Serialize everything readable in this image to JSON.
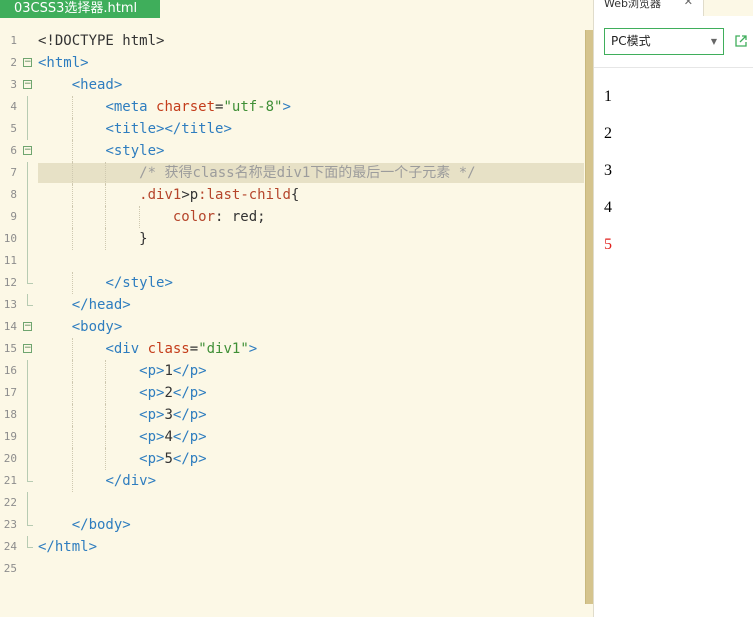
{
  "editor": {
    "file_tab": "03CSS3选择器.html",
    "lines": [
      {
        "n": "1",
        "fold": "",
        "segments": [
          {
            "c": "plain",
            "t": "<!DOCTYPE html>"
          }
        ]
      },
      {
        "n": "2",
        "fold": "open",
        "segments": [
          {
            "c": "tag",
            "t": "<html>"
          }
        ]
      },
      {
        "n": "3",
        "fold": "open",
        "segments": [
          {
            "c": "plain",
            "t": "    "
          },
          {
            "c": "tag",
            "t": "<head>"
          }
        ]
      },
      {
        "n": "4",
        "fold": "line",
        "segments": [
          {
            "c": "plain",
            "t": "        "
          },
          {
            "c": "tag",
            "t": "<meta "
          },
          {
            "c": "attr",
            "t": "charset"
          },
          {
            "c": "plain",
            "t": "="
          },
          {
            "c": "val",
            "t": "\"utf-8\""
          },
          {
            "c": "tag",
            "t": ">"
          }
        ]
      },
      {
        "n": "5",
        "fold": "line",
        "segments": [
          {
            "c": "plain",
            "t": "        "
          },
          {
            "c": "tag",
            "t": "<title></title>"
          }
        ]
      },
      {
        "n": "6",
        "fold": "open",
        "segments": [
          {
            "c": "plain",
            "t": "        "
          },
          {
            "c": "tag",
            "t": "<style>"
          }
        ]
      },
      {
        "n": "7",
        "fold": "line",
        "hl": true,
        "segments": [
          {
            "c": "plain",
            "t": "            "
          },
          {
            "c": "cmt",
            "t": "/* 获得class名称是div1下面的最后一个子元素 */"
          }
        ]
      },
      {
        "n": "8",
        "fold": "line",
        "segments": [
          {
            "c": "plain",
            "t": "            "
          },
          {
            "c": "sel",
            "t": ".div1"
          },
          {
            "c": "plain",
            "t": ">p"
          },
          {
            "c": "sel",
            "t": ":last-child"
          },
          {
            "c": "plain",
            "t": "{"
          }
        ]
      },
      {
        "n": "9",
        "fold": "line",
        "segments": [
          {
            "c": "plain",
            "t": "                "
          },
          {
            "c": "sel",
            "t": "color"
          },
          {
            "c": "plain",
            "t": ": red;"
          }
        ]
      },
      {
        "n": "10",
        "fold": "line",
        "segments": [
          {
            "c": "plain",
            "t": "            }"
          }
        ]
      },
      {
        "n": "11",
        "fold": "line",
        "segments": [
          {
            "c": "plain",
            "t": ""
          }
        ]
      },
      {
        "n": "12",
        "fold": "end",
        "segments": [
          {
            "c": "plain",
            "t": "        "
          },
          {
            "c": "tag",
            "t": "</style>"
          }
        ]
      },
      {
        "n": "13",
        "fold": "end",
        "segments": [
          {
            "c": "plain",
            "t": "    "
          },
          {
            "c": "tag",
            "t": "</head>"
          }
        ]
      },
      {
        "n": "14",
        "fold": "open",
        "segments": [
          {
            "c": "plain",
            "t": "    "
          },
          {
            "c": "tag",
            "t": "<body>"
          }
        ]
      },
      {
        "n": "15",
        "fold": "open",
        "segments": [
          {
            "c": "plain",
            "t": "        "
          },
          {
            "c": "tag",
            "t": "<div "
          },
          {
            "c": "attr",
            "t": "class"
          },
          {
            "c": "plain",
            "t": "="
          },
          {
            "c": "val",
            "t": "\"div1\""
          },
          {
            "c": "tag",
            "t": ">"
          }
        ]
      },
      {
        "n": "16",
        "fold": "line",
        "segments": [
          {
            "c": "plain",
            "t": "            "
          },
          {
            "c": "tag",
            "t": "<p>"
          },
          {
            "c": "plain",
            "t": "1"
          },
          {
            "c": "tag",
            "t": "</p>"
          }
        ]
      },
      {
        "n": "17",
        "fold": "line",
        "segments": [
          {
            "c": "plain",
            "t": "            "
          },
          {
            "c": "tag",
            "t": "<p>"
          },
          {
            "c": "plain",
            "t": "2"
          },
          {
            "c": "tag",
            "t": "</p>"
          }
        ]
      },
      {
        "n": "18",
        "fold": "line",
        "segments": [
          {
            "c": "plain",
            "t": "            "
          },
          {
            "c": "tag",
            "t": "<p>"
          },
          {
            "c": "plain",
            "t": "3"
          },
          {
            "c": "tag",
            "t": "</p>"
          }
        ]
      },
      {
        "n": "19",
        "fold": "line",
        "segments": [
          {
            "c": "plain",
            "t": "            "
          },
          {
            "c": "tag",
            "t": "<p>"
          },
          {
            "c": "plain",
            "t": "4"
          },
          {
            "c": "tag",
            "t": "</p>"
          }
        ]
      },
      {
        "n": "20",
        "fold": "line",
        "segments": [
          {
            "c": "plain",
            "t": "            "
          },
          {
            "c": "tag",
            "t": "<p>"
          },
          {
            "c": "plain",
            "t": "5"
          },
          {
            "c": "tag",
            "t": "</p>"
          }
        ]
      },
      {
        "n": "21",
        "fold": "end",
        "segments": [
          {
            "c": "plain",
            "t": "        "
          },
          {
            "c": "tag",
            "t": "</div>"
          }
        ]
      },
      {
        "n": "22",
        "fold": "line",
        "segments": [
          {
            "c": "plain",
            "t": ""
          }
        ]
      },
      {
        "n": "23",
        "fold": "end",
        "segments": [
          {
            "c": "plain",
            "t": "    "
          },
          {
            "c": "tag",
            "t": "</body>"
          }
        ]
      },
      {
        "n": "24",
        "fold": "end",
        "segments": [
          {
            "c": "tag",
            "t": "</html>"
          }
        ]
      },
      {
        "n": "25",
        "fold": "",
        "segments": [
          {
            "c": "plain",
            "t": ""
          }
        ]
      }
    ]
  },
  "browser": {
    "tab_label": "Web浏览器",
    "close_icon": "close-icon",
    "mode_selected": "PC模式",
    "external_icon": "open-external-icon",
    "accent_color": "#3fae5b",
    "paragraphs": [
      {
        "text": "1",
        "color": "#000000"
      },
      {
        "text": "2",
        "color": "#000000"
      },
      {
        "text": "3",
        "color": "#000000"
      },
      {
        "text": "4",
        "color": "#000000"
      },
      {
        "text": "5",
        "color": "#e0201d"
      }
    ]
  }
}
